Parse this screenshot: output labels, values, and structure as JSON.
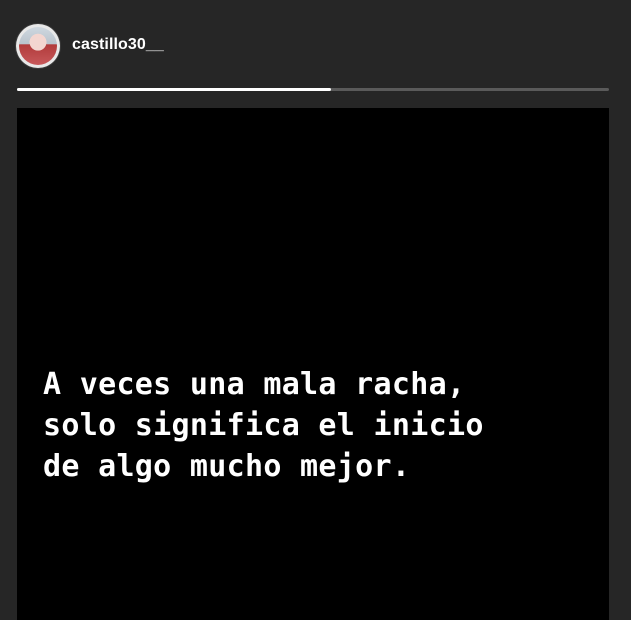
{
  "header": {
    "username": "castillo30__",
    "progress": 0.53
  },
  "story": {
    "lines": [
      "A veces una mala racha,",
      "solo significa el inicio",
      "de algo mucho mejor."
    ]
  },
  "colors": {
    "background": "#262626",
    "story_background": "#000000",
    "text": "#ffffff",
    "progress_track": "#5a5a5a",
    "progress_fill": "#ffffff"
  }
}
